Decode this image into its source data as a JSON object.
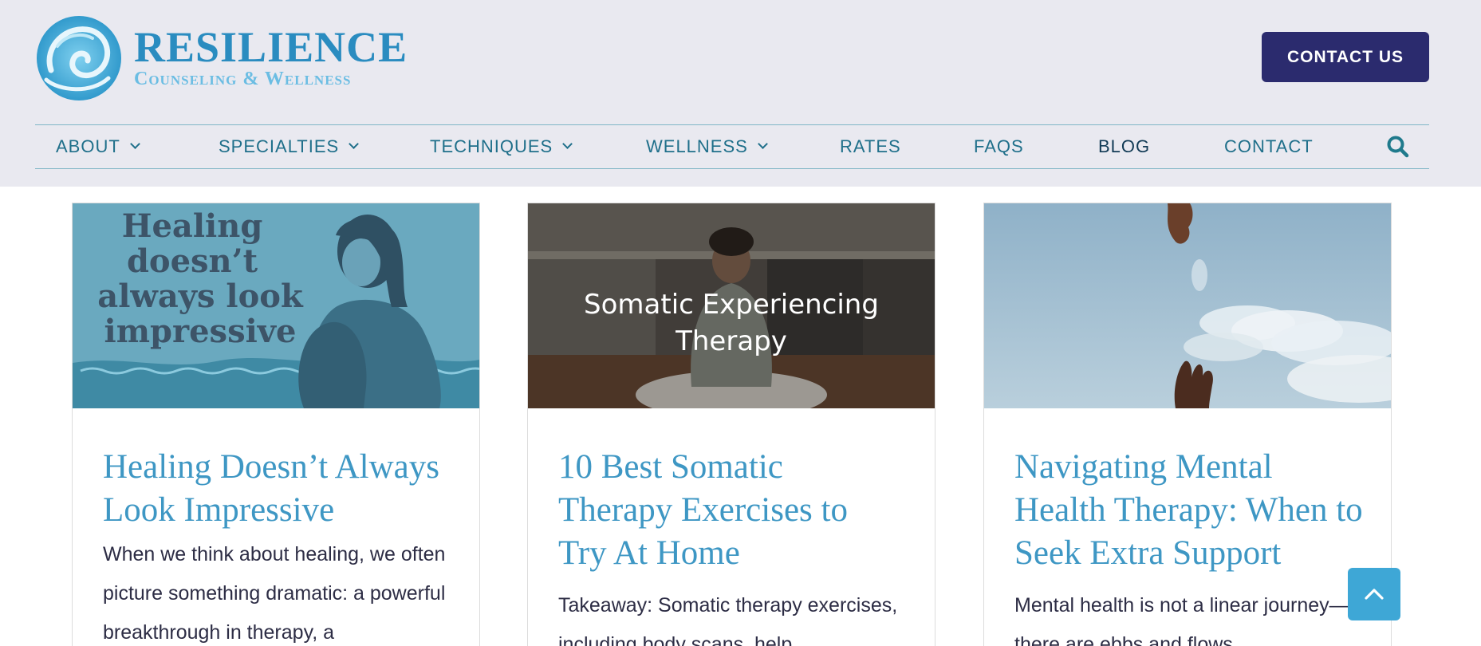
{
  "brand": {
    "name": "RESILIENCE",
    "tagline": "Counseling & Wellness",
    "logo_icon": "wave-swirl-icon",
    "colors": {
      "primary": "#2a8cc0",
      "light": "#6bbde3",
      "navy": "#2b2b6e",
      "header_bg": "#e9e9f0"
    }
  },
  "header": {
    "contact_button": "CONTACT US"
  },
  "nav": {
    "items": [
      {
        "label": "ABOUT",
        "dropdown": true
      },
      {
        "label": "SPECIALTIES",
        "dropdown": true
      },
      {
        "label": "TECHNIQUES",
        "dropdown": true
      },
      {
        "label": "WELLNESS",
        "dropdown": true
      },
      {
        "label": "RATES",
        "dropdown": false
      },
      {
        "label": "FAQS",
        "dropdown": false
      },
      {
        "label": "BLOG",
        "dropdown": false,
        "active": true
      },
      {
        "label": "CONTACT",
        "dropdown": false
      }
    ],
    "search_icon": "search-icon"
  },
  "posts": [
    {
      "image_text": [
        "Healing",
        "doesn’t",
        "always look",
        "impressive"
      ],
      "title": "Healing Doesn’t Always Look Impressive",
      "excerpt": "When we think about healing, we often picture something dramatic: a powerful breakthrough in therapy, a"
    },
    {
      "image_text": [
        "Somatic Experiencing",
        "Therapy"
      ],
      "title": "10 Best Somatic Therapy Exercises to Try At Home",
      "excerpt": "Takeaway: Somatic therapy exercises, including body scans, help"
    },
    {
      "image_text": [],
      "title": "Navigating Mental Health Therapy: When to Seek Extra Support",
      "excerpt": "Mental health is not a linear journey—there are ebbs and flows."
    }
  ],
  "back_to_top_icon": "chevron-up-icon"
}
